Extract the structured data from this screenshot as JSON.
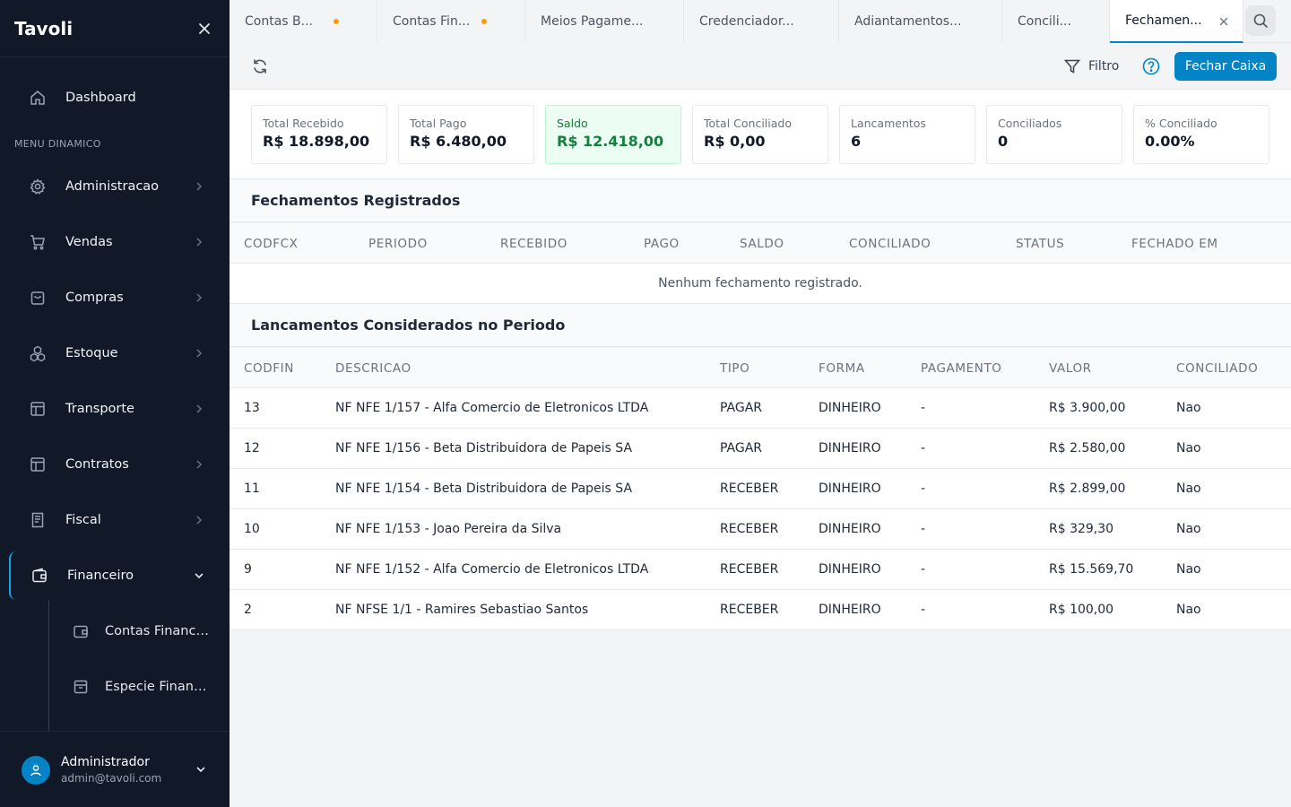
{
  "sidebar": {
    "brand": "Tavoli",
    "section_label": "MENU DINAMICO",
    "dashboard": "Dashboard",
    "items": [
      {
        "label": "Administracao",
        "icon": "gear-icon"
      },
      {
        "label": "Vendas",
        "icon": "cart-icon"
      },
      {
        "label": "Compras",
        "icon": "bag-icon"
      },
      {
        "label": "Estoque",
        "icon": "boxes-icon"
      },
      {
        "label": "Transporte",
        "icon": "layout-icon"
      },
      {
        "label": "Contratos",
        "icon": "layout-icon"
      },
      {
        "label": "Fiscal",
        "icon": "receipt-icon"
      },
      {
        "label": "Financeiro",
        "icon": "wallet-icon"
      }
    ],
    "subitems": [
      {
        "label": "Contas Financeiras"
      },
      {
        "label": "Especie Financeira"
      }
    ],
    "user": {
      "name": "Administrador",
      "email": "admin@tavoli.com"
    }
  },
  "tabs": [
    {
      "label": "Contas B..."
    },
    {
      "label": "Contas Fin..."
    },
    {
      "label": "Meios Pagame..."
    },
    {
      "label": "Credenciador..."
    },
    {
      "label": "Adiantamentos..."
    },
    {
      "label": "Concili..."
    },
    {
      "label": "Fechamen..."
    }
  ],
  "toolbar": {
    "filter_label": "Filtro",
    "close_button": "Fechar Caixa"
  },
  "cards": [
    {
      "label": "Total Recebido",
      "value": "R$ 18.898,00"
    },
    {
      "label": "Total Pago",
      "value": "R$ 6.480,00"
    },
    {
      "label": "Saldo",
      "value": "R$ 12.418,00"
    },
    {
      "label": "Total Conciliado",
      "value": "R$ 0,00"
    },
    {
      "label": "Lancamentos",
      "value": "6"
    },
    {
      "label": "Conciliados",
      "value": "0"
    },
    {
      "label": "% Conciliado",
      "value": "0.00%"
    }
  ],
  "fechamentos": {
    "title": "Fechamentos Registrados",
    "columns": [
      "CODFCX",
      "PERIODO",
      "RECEBIDO",
      "PAGO",
      "SALDO",
      "CONCILIADO",
      "STATUS",
      "FECHADO EM"
    ],
    "empty": "Nenhum fechamento registrado."
  },
  "lancamentos": {
    "title": "Lancamentos Considerados no Periodo",
    "columns": [
      "CODFIN",
      "DESCRICAO",
      "TIPO",
      "FORMA",
      "PAGAMENTO",
      "VALOR",
      "CONCILIADO"
    ],
    "rows": [
      [
        "13",
        "NF NFE 1/157 - Alfa Comercio de Eletronicos LTDA",
        "PAGAR",
        "DINHEIRO",
        "-",
        "R$ 3.900,00",
        "Nao"
      ],
      [
        "12",
        "NF NFE 1/156 - Beta Distribuidora de Papeis SA",
        "PAGAR",
        "DINHEIRO",
        "-",
        "R$ 2.580,00",
        "Nao"
      ],
      [
        "11",
        "NF NFE 1/154 - Beta Distribuidora de Papeis SA",
        "RECEBER",
        "DINHEIRO",
        "-",
        "R$ 2.899,00",
        "Nao"
      ],
      [
        "10",
        "NF NFE 1/153 - Joao Pereira da Silva",
        "RECEBER",
        "DINHEIRO",
        "-",
        "R$ 329,30",
        "Nao"
      ],
      [
        "9",
        "NF NFE 1/152 - Alfa Comercio de Eletronicos LTDA",
        "RECEBER",
        "DINHEIRO",
        "-",
        "R$ 15.569,70",
        "Nao"
      ],
      [
        "2",
        "NF NFSE 1/1 - Ramires Sebastiao Santos",
        "RECEBER",
        "DINHEIRO",
        "-",
        "R$ 100,00",
        "Nao"
      ]
    ]
  }
}
